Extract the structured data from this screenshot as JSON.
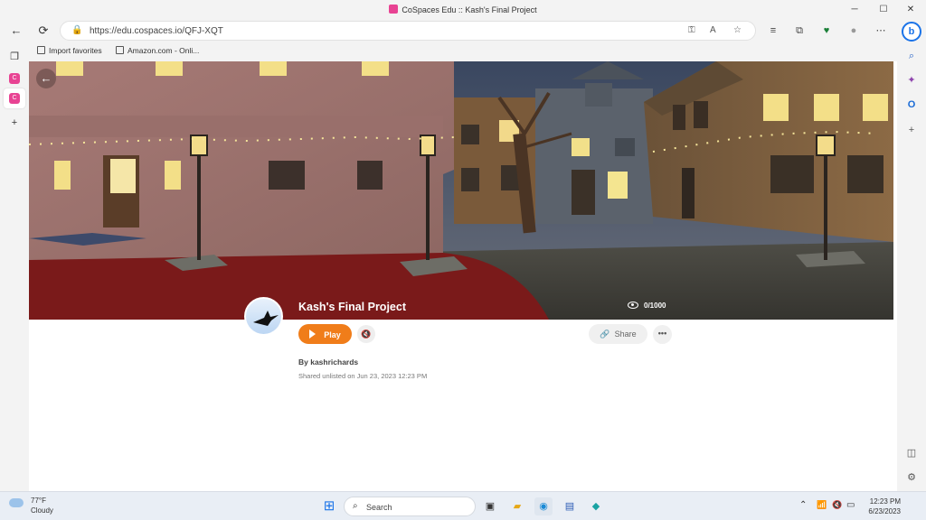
{
  "window": {
    "title": "CoSpaces Edu :: Kash's Final Project",
    "controls": {
      "minimize": "─",
      "maximize": "☐",
      "close": "✕"
    }
  },
  "browser": {
    "url": "https://edu.cospaces.io/QFJ-XQT",
    "favorites": [
      {
        "label": "Import favorites"
      },
      {
        "label": "Amazon.com - Onli..."
      }
    ],
    "icons": {
      "back": "←",
      "refresh": "⟳",
      "lock": "🔒",
      "key": "⚿",
      "read_aloud": "A",
      "star": "☆",
      "favorites": "≡",
      "collections": "⧉",
      "extensions": "♥",
      "profile": "●",
      "more": "⋯",
      "bing": "b"
    }
  },
  "sidebar_left": {
    "tabs": "❐",
    "plus": "+"
  },
  "sidebar_right": {
    "search": "⌕",
    "copilot": "✦",
    "outlook": "O",
    "add": "+",
    "split": "◫",
    "settings": "⚙"
  },
  "project": {
    "title": "Kash's Final Project",
    "views": "0/1000",
    "play_label": "Play",
    "mute_icon": "🔇",
    "share_label": "Share",
    "share_icon": "🔗",
    "more_label": "•••",
    "author": "By kashrichards",
    "shared": "Shared unlisted on Jun 23, 2023 12:23 PM",
    "accent_color": "#f07d1a"
  },
  "taskbar": {
    "temperature": "77°F",
    "condition": "Cloudy",
    "search_label": "Search",
    "time": "12:23 PM",
    "date": "6/23/2023",
    "tray_icons": {
      "chevron": "⌃",
      "wifi": "📶",
      "volume": "🔇",
      "battery": "▭"
    }
  }
}
